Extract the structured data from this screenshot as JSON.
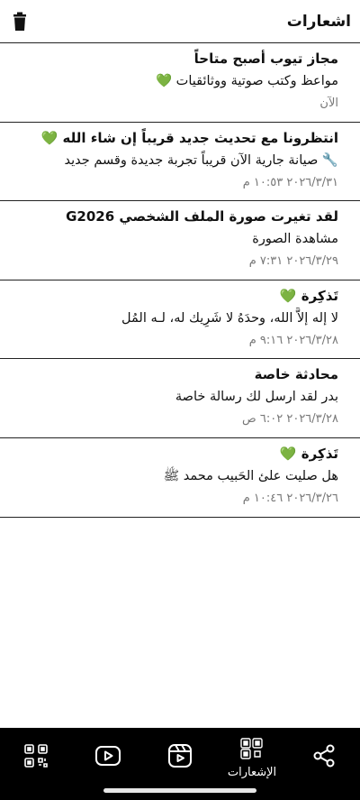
{
  "header": {
    "title": "اشعارات",
    "trash_icon": "trash-icon"
  },
  "colors": {
    "accent": "#4cae3a",
    "nav_bg": "#000000",
    "date_text": "#777777"
  },
  "notifications": [
    {
      "title": "مجاز تيوب أصبح متاحاً",
      "body": "مواعظ وكتب صوتية ووثائقيات 💚",
      "date": "الآن"
    },
    {
      "title": "انتظرونا مع تحديث جديد قريباً إن شاء الله 💚",
      "body": "🔧 صيانة جارية الآن  قريباً تجربة جديدة وقسم جديد",
      "date": "٢٠٢٦/٣/٣١ ١٠:٥٣ م"
    },
    {
      "title": "لقد تغيرت صورة الملف الشخصي G2026",
      "body": "مشاهدة الصورة",
      "date": "٢٠٢٦/٣/٢٩ ٧:٣١ م"
    },
    {
      "title": "تَذكِرة 💚",
      "body": "لا إله إلاَّ الله، وحدَهُ لا شَرِيك له، لـه المُل",
      "date": "٢٠٢٦/٣/٢٨ ٩:١٦ م"
    },
    {
      "title": "محادثة خاصة",
      "body": "بدر لقد ارسل لك رسالة خاصة",
      "date": "٢٠٢٦/٣/٢٨ ٦:٠٢ ص"
    },
    {
      "title": "تَذكِرة 💚",
      "body": "هل صليت علئ الحَبيب محمد ﷺ",
      "date": "٢٠٢٦/٣/٢٦ ١٠:٤٦ م"
    }
  ],
  "nav": [
    {
      "icon": "qr-grid-icon",
      "label": ""
    },
    {
      "icon": "video-play-icon",
      "label": ""
    },
    {
      "icon": "film-play-icon",
      "label": ""
    },
    {
      "icon": "notifications-icon",
      "label": "الإشعارات"
    },
    {
      "icon": "share-icon",
      "label": ""
    }
  ]
}
